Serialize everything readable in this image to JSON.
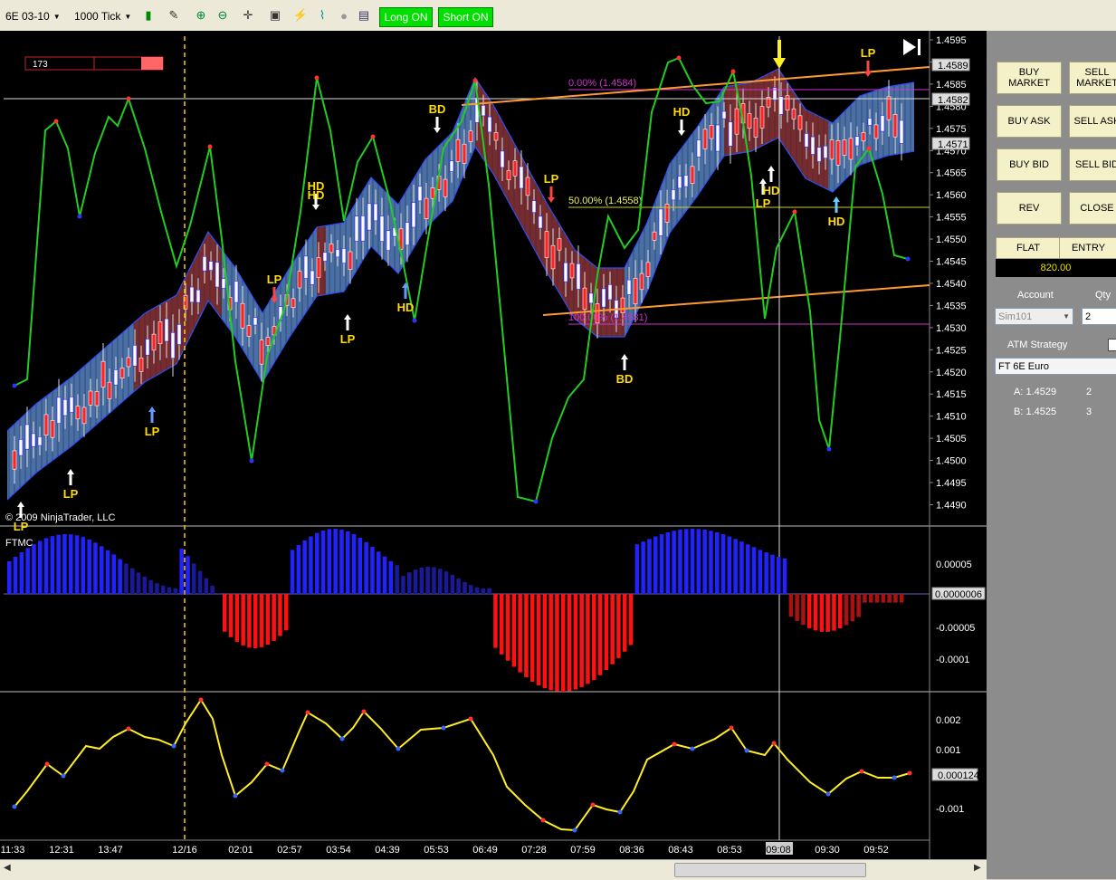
{
  "toolbar": {
    "instrument": "6E 03-10",
    "interval": "1000 Tick",
    "long_label": "Long ON",
    "short_label": "Short ON",
    "icons": [
      "candlestick-icon",
      "pencil-icon",
      "zoom-in-icon",
      "zoom-out-icon",
      "crosshair-icon",
      "properties-icon",
      "strategy-icon",
      "indicators-icon",
      "sphere-icon",
      "data-box-icon"
    ]
  },
  "chart": {
    "copyright": "© 2009 NinjaTrader, LLC",
    "counter": "173",
    "price_ticks": [
      "1.4595",
      "1.4590",
      "1.4585",
      "1.4580",
      "1.4575",
      "1.4570",
      "1.4565",
      "1.4560",
      "1.4555",
      "1.4550",
      "1.4545",
      "1.4540",
      "1.4535",
      "1.4530",
      "1.4525",
      "1.4520",
      "1.4515",
      "1.4510",
      "1.4505",
      "1.4500",
      "1.4495",
      "1.4490"
    ],
    "price_tags": [
      "1.4589",
      "1.4582",
      "1.4571"
    ],
    "fib_levels": [
      "0.00% (1.4584)",
      "50.00% (1.4558)",
      "100.00% (1.4531)"
    ],
    "signals": [
      "LP",
      "LP",
      "LP",
      "LP",
      "LP",
      "HD",
      "LP",
      "HD",
      "BD",
      "LP",
      "BD",
      "HD",
      "LP",
      "HD",
      "LP",
      "HD"
    ],
    "ftmc_label": "FTMC",
    "ftmc_ticks": [
      "0.00005",
      "-0.00005",
      "-0.0001"
    ],
    "ftmc_tag": "0.0000006",
    "osc_ticks": [
      "0.002",
      "0.001",
      "-0.001"
    ],
    "osc_tag": "0.000124",
    "time_labels": [
      "11:33",
      "12:31",
      "13:47",
      "12/16",
      "02:01",
      "02:57",
      "03:54",
      "04:39",
      "05:53",
      "06:49",
      "07:28",
      "07:59",
      "08:36",
      "08:43",
      "08:53",
      "09:08",
      "09:30",
      "09:52"
    ],
    "colors": {
      "band_up": "#4a6fa5",
      "band_down": "#7a2a2a",
      "oscillator": "#22cc22",
      "yellow": "#ffcc00",
      "fib": "#cc33cc",
      "trend": "#ff9933"
    }
  },
  "panel": {
    "buy_market": "BUY MARKET",
    "sell_market": "SELL MARKET",
    "buy_ask": "BUY ASK",
    "sell_ask": "SELL ASK",
    "buy_bid": "BUY BID",
    "sell_bid": "SELL BID",
    "rev": "REV",
    "close": "CLOSE",
    "flat": "FLAT",
    "entry": "ENTRY",
    "pnl": "820.00",
    "account_label": "Account",
    "qty_label": "Qty",
    "account": "Sim101",
    "qty": "2",
    "atm_label": "ATM Strategy",
    "atm_value": "FT 6E Euro",
    "level_a": "A: 1.4529",
    "level_a_qty": "2",
    "level_b": "B: 1.4525",
    "level_b_qty": "3"
  }
}
